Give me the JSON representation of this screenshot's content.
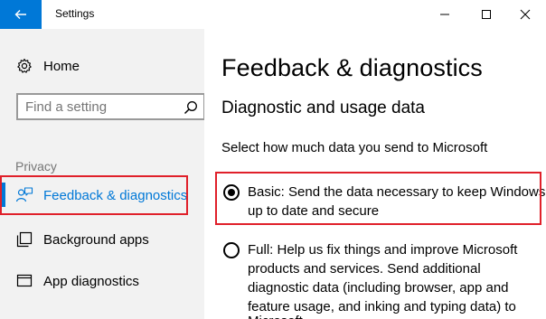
{
  "window": {
    "title": "Settings",
    "controls": [
      "minimize",
      "maximize",
      "close"
    ]
  },
  "sidebar": {
    "home_label": "Home",
    "search_placeholder": "Find a setting",
    "section_label": "Privacy",
    "items": [
      {
        "label": "Feedback & diagnostics",
        "icon": "feedback-icon",
        "active": true
      },
      {
        "label": "Background apps",
        "icon": "background-apps-icon",
        "active": false
      },
      {
        "label": "App diagnostics",
        "icon": "app-diagnostics-icon",
        "active": false
      }
    ]
  },
  "main": {
    "title": "Feedback & diagnostics",
    "subtitle": "Diagnostic and usage data",
    "prompt": "Select how much data you send to Microsoft",
    "options": [
      {
        "line1": "Basic: Send the data necessary to keep Windows",
        "line2": "up to date and secure",
        "selected": true
      },
      {
        "line1": "Full: Help us fix things and improve Microsoft",
        "line2": "products and services. Send additional",
        "line3": "diagnostic data (including browser, app and",
        "line4": "feature usage, and inking and typing data) to",
        "line5": "Microsoft",
        "selected": false
      }
    ]
  },
  "colors": {
    "accent": "#0078d7",
    "highlight": "#e0202a",
    "sidebar_bg": "#f2f2f2",
    "section_label": "#767676"
  }
}
